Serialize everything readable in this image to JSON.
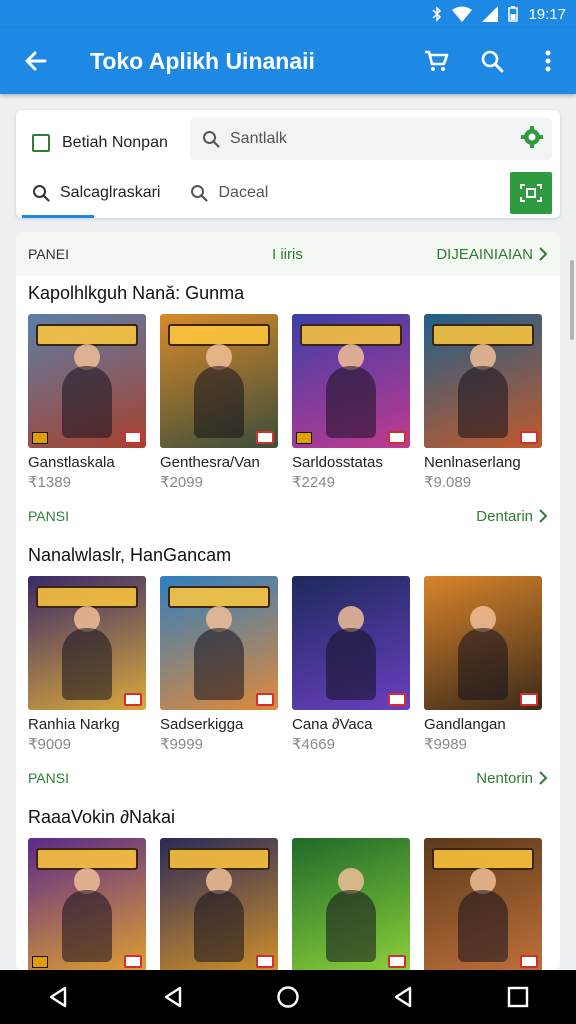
{
  "status": {
    "time": "19:17"
  },
  "appbar": {
    "title": "Toko Aplikh Uinanaii"
  },
  "filters": {
    "checkbox_label": "Betiah Nonpan",
    "search_placeholder": "Santlalk",
    "tab1": "Salcaglraskari",
    "tab2": "Daceal"
  },
  "sections": [
    {
      "tag": "PANEI",
      "mid": "I iiris",
      "more": "DIJEAINIAIAN",
      "title": "Kapolhlkguh Nană: Gunma",
      "cards": [
        {
          "name": "Ganstlaskala",
          "price": "₹1389",
          "c1": "#5b7fa8",
          "c2": "#a8412e"
        },
        {
          "name": "Genthesra/Van",
          "price": "₹2099",
          "c1": "#d98a2b",
          "c2": "#3b4d3a"
        },
        {
          "name": "Sarldosstatas",
          "price": "₹2249",
          "c1": "#3b3fa8",
          "c2": "#c03a8f"
        },
        {
          "name": "Nenlnaserlang",
          "price": "₹9.089",
          "c1": "#1f5f8c",
          "c2": "#c25a2a"
        }
      ]
    },
    {
      "tag": "PANSI",
      "mid": "",
      "more": "Dentarin",
      "title": "Nanalwlaslr, HanGancam",
      "cards": [
        {
          "name": "Ranhia Narkg",
          "price": "₹9009",
          "c1": "#3a2a6a",
          "c2": "#d9a93a"
        },
        {
          "name": "Sadserkigga",
          "price": "₹9999",
          "c1": "#2f7fbf",
          "c2": "#e0893a"
        },
        {
          "name": "Cana ∂Vaca",
          "price": "₹4669",
          "c1": "#1d2a5c",
          "c2": "#6a3fc0"
        },
        {
          "name": "Gandlangan",
          "price": "₹9989",
          "c1": "#d9842a",
          "c2": "#3a2a1a"
        }
      ]
    },
    {
      "tag": "PANSI",
      "mid": "",
      "more": "Nentorin",
      "title": "RaaaVokin ∂Nakai",
      "cards": [
        {
          "name": "",
          "price": "",
          "c1": "#5a2a8c",
          "c2": "#e0a030"
        },
        {
          "name": "",
          "price": "",
          "c1": "#2a2a5a",
          "c2": "#d0902a"
        },
        {
          "name": "",
          "price": "",
          "c1": "#1f6a2a",
          "c2": "#8cd03a"
        },
        {
          "name": "",
          "price": "",
          "c1": "#5a3a1a",
          "c2": "#c0703a"
        }
      ]
    }
  ]
}
